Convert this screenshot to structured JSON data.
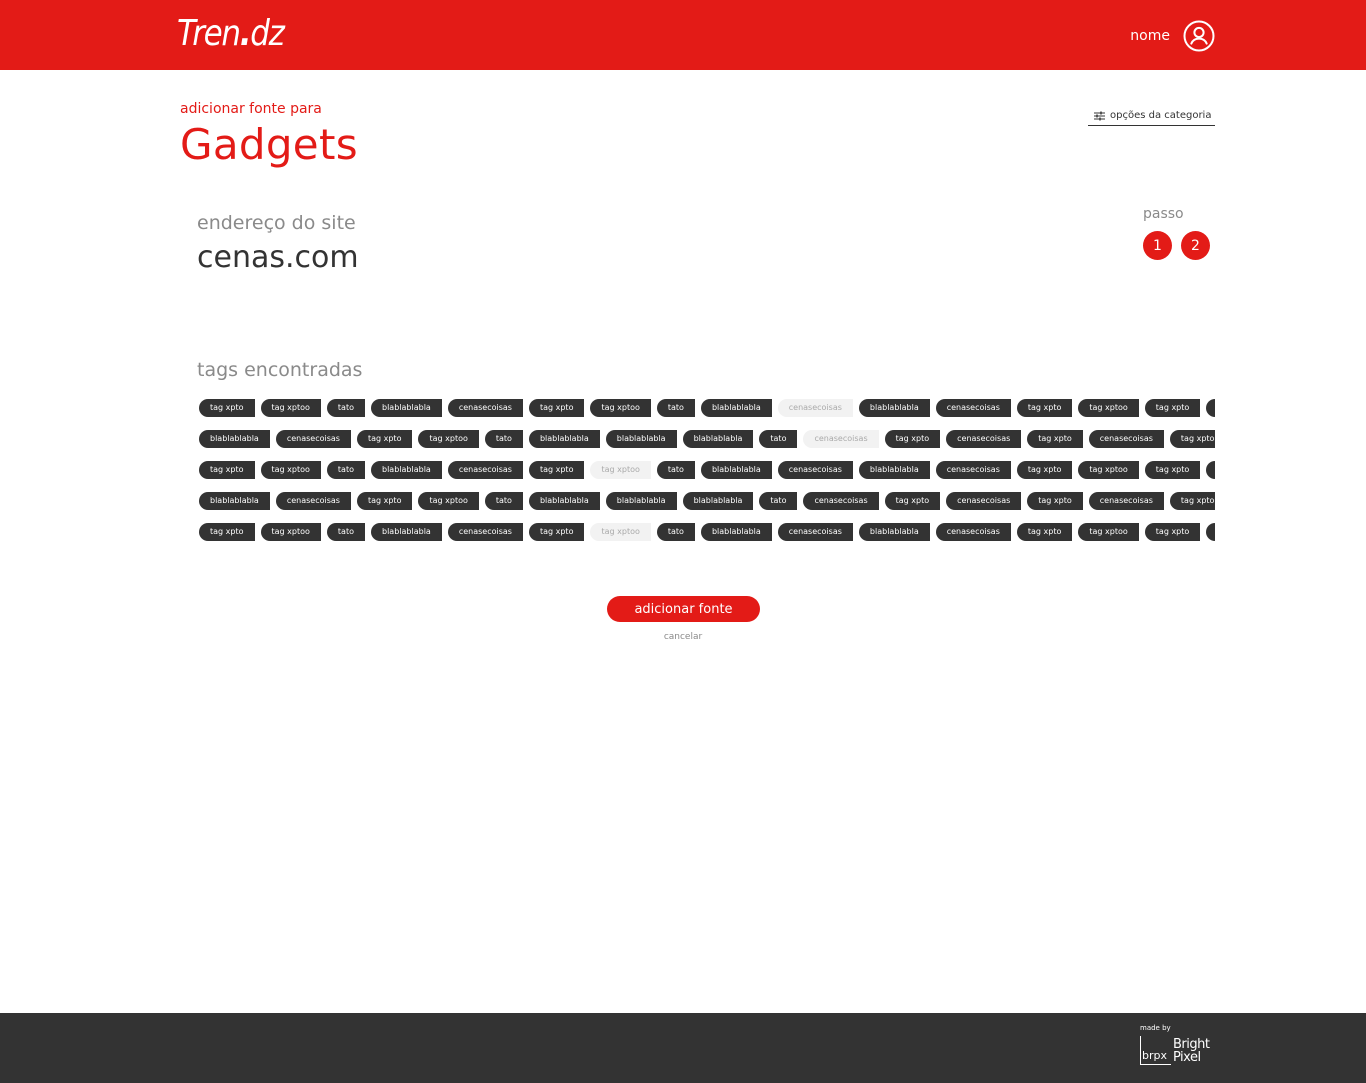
{
  "brand": {
    "logo_text_a": "Tren",
    "logo_dot": ".",
    "logo_text_b": "dz",
    "accent_color": "#e31b17",
    "dark_color": "#333333"
  },
  "header": {
    "user_name": "nome",
    "user_icon": "user-circle-icon"
  },
  "page": {
    "eyebrow": "adicionar fonte para",
    "title": "Gadgets"
  },
  "category_options": {
    "label": "opções da categoria",
    "icon": "sliders-icon"
  },
  "site": {
    "label": "endereço do site",
    "value": "cenas.com"
  },
  "steps": {
    "label": "passo",
    "items": [
      "1",
      "2"
    ]
  },
  "tags": {
    "label": "tags encontradas",
    "rows": [
      [
        {
          "t": "tag xpto",
          "on": true
        },
        {
          "t": "tag xptoo",
          "on": true
        },
        {
          "t": "tato",
          "on": true
        },
        {
          "t": "blablablabla",
          "on": true
        },
        {
          "t": "cenasecoisas",
          "on": true
        },
        {
          "t": "tag xpto",
          "on": true
        },
        {
          "t": "tag xptoo",
          "on": true
        },
        {
          "t": "tato",
          "on": true
        },
        {
          "t": "blablablabla",
          "on": true
        },
        {
          "t": "cenasecoisas",
          "on": false
        },
        {
          "t": "blablablabla",
          "on": true
        },
        {
          "t": "cenasecoisas",
          "on": true
        },
        {
          "t": "tag xpto",
          "on": true
        },
        {
          "t": "tag xptoo",
          "on": true
        },
        {
          "t": "tag xpto",
          "on": true
        },
        {
          "t": "tag xptoo",
          "on": true
        }
      ],
      [
        {
          "t": "blablablabla",
          "on": true
        },
        {
          "t": "cenasecoisas",
          "on": true
        },
        {
          "t": "tag xpto",
          "on": true
        },
        {
          "t": "tag xptoo",
          "on": true
        },
        {
          "t": "tato",
          "on": true
        },
        {
          "t": "blablablabla",
          "on": true
        },
        {
          "t": "blablablabla",
          "on": true
        },
        {
          "t": "blablablabla",
          "on": true
        },
        {
          "t": "tato",
          "on": true
        },
        {
          "t": "cenasecoisas",
          "on": false
        },
        {
          "t": "tag xpto",
          "on": true
        },
        {
          "t": "cenasecoisas",
          "on": true
        },
        {
          "t": "tag xpto",
          "on": true
        },
        {
          "t": "cenasecoisas",
          "on": true
        },
        {
          "t": "tag xpto",
          "on": true
        }
      ],
      [
        {
          "t": "tag xpto",
          "on": true
        },
        {
          "t": "tag xptoo",
          "on": true
        },
        {
          "t": "tato",
          "on": true
        },
        {
          "t": "blablablabla",
          "on": true
        },
        {
          "t": "cenasecoisas",
          "on": true
        },
        {
          "t": "tag xpto",
          "on": true
        },
        {
          "t": "tag xptoo",
          "on": false
        },
        {
          "t": "tato",
          "on": true
        },
        {
          "t": "blablablabla",
          "on": true
        },
        {
          "t": "cenasecoisas",
          "on": true
        },
        {
          "t": "blablablabla",
          "on": true
        },
        {
          "t": "cenasecoisas",
          "on": true
        },
        {
          "t": "tag xpto",
          "on": true
        },
        {
          "t": "tag xptoo",
          "on": true
        },
        {
          "t": "tag xpto",
          "on": true
        },
        {
          "t": "tag xptoo",
          "on": true
        }
      ],
      [
        {
          "t": "blablablabla",
          "on": true
        },
        {
          "t": "cenasecoisas",
          "on": true
        },
        {
          "t": "tag xpto",
          "on": true
        },
        {
          "t": "tag xptoo",
          "on": true
        },
        {
          "t": "tato",
          "on": true
        },
        {
          "t": "blablablabla",
          "on": true
        },
        {
          "t": "blablablabla",
          "on": true
        },
        {
          "t": "blablablabla",
          "on": true
        },
        {
          "t": "tato",
          "on": true
        },
        {
          "t": "cenasecoisas",
          "on": true
        },
        {
          "t": "tag xpto",
          "on": true
        },
        {
          "t": "cenasecoisas",
          "on": true
        },
        {
          "t": "tag xpto",
          "on": true
        },
        {
          "t": "cenasecoisas",
          "on": true
        },
        {
          "t": "tag xpto",
          "on": true
        }
      ],
      [
        {
          "t": "tag xpto",
          "on": true
        },
        {
          "t": "tag xptoo",
          "on": true
        },
        {
          "t": "tato",
          "on": true
        },
        {
          "t": "blablablabla",
          "on": true
        },
        {
          "t": "cenasecoisas",
          "on": true
        },
        {
          "t": "tag xpto",
          "on": true
        },
        {
          "t": "tag xptoo",
          "on": false
        },
        {
          "t": "tato",
          "on": true
        },
        {
          "t": "blablablabla",
          "on": true
        },
        {
          "t": "cenasecoisas",
          "on": true
        },
        {
          "t": "blablablabla",
          "on": true
        },
        {
          "t": "cenasecoisas",
          "on": true
        },
        {
          "t": "tag xpto",
          "on": true
        },
        {
          "t": "tag xptoo",
          "on": true
        },
        {
          "t": "tag xpto",
          "on": true
        },
        {
          "t": "tag xptoo",
          "on": true
        }
      ]
    ]
  },
  "actions": {
    "submit_label": "adicionar fonte",
    "cancel_label": "cancelar"
  },
  "footer": {
    "made_by": "made by",
    "logo_mark": "brpx",
    "logo_line1": "Bright",
    "logo_line2": "Pixel"
  }
}
